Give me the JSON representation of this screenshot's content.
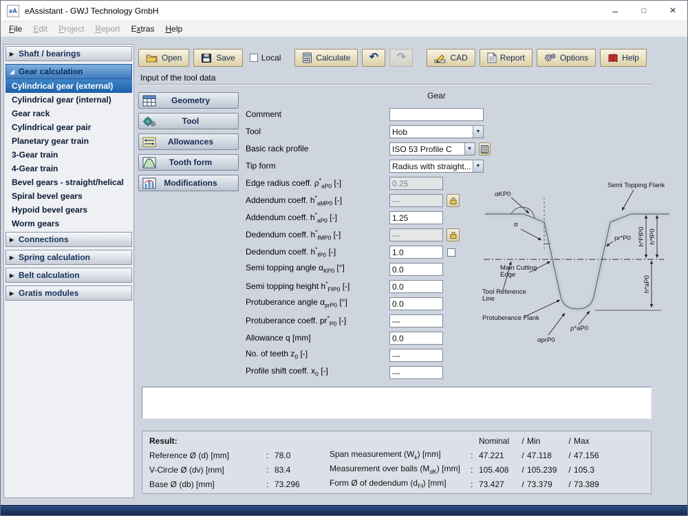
{
  "window": {
    "title": "eAssistant - GWJ Technology GmbH",
    "icon_text": "eA",
    "minimize": "–",
    "maximize": "□",
    "close": "×"
  },
  "menu": {
    "items": [
      {
        "pre": "",
        "key": "F",
        "post": "ile"
      },
      {
        "pre": "",
        "key": "E",
        "post": "dit"
      },
      {
        "pre": "",
        "key": "P",
        "post": "roject"
      },
      {
        "pre": "",
        "key": "R",
        "post": "eport"
      },
      {
        "pre": "E",
        "key": "x",
        "post": "tras"
      },
      {
        "pre": "",
        "key": "H",
        "post": "elp"
      }
    ]
  },
  "icons": {
    "collapsed_arrow": "▶",
    "expanded_arrow": "◢",
    "dropdown_arrow": "▼",
    "undo": "↶",
    "redo": "↷"
  },
  "sidebar": {
    "sections": {
      "shaft": "Shaft / bearings",
      "gear": "Gear calculation",
      "connections": "Connections",
      "spring": "Spring calculation",
      "belt": "Belt calculation",
      "gratis": "Gratis modules"
    },
    "gear_items": [
      "Cylindrical gear (external)",
      "Cylindrical gear (internal)",
      "Gear rack",
      "Cylindrical gear pair",
      "Planetary gear train",
      "3-Gear train",
      "4-Gear train",
      "Bevel gears - straight/helical",
      "Spiral bevel gears",
      "Hypoid bevel gears",
      "Worm gears"
    ]
  },
  "toolbar": {
    "open": "Open",
    "save": "Save",
    "local": "Local",
    "calculate": "Calculate",
    "cad": "CAD",
    "report": "Report",
    "options": "Options",
    "help": "Help"
  },
  "main": {
    "section_title": "Input of the tool data",
    "column_header": "Gear"
  },
  "nav_buttons": [
    "Geometry",
    "Tool",
    "Allowances",
    "Tooth form",
    "Modifications"
  ],
  "form": {
    "fields": [
      {
        "l1": "Comment",
        "value": ""
      },
      {
        "l1": "Tool",
        "value": "Hob"
      },
      {
        "l1": "Basic rack profile",
        "value": "ISO 53 Profile C"
      },
      {
        "l1": "Tip form",
        "value": "Radius with straight..."
      },
      {
        "l1": "Edge radius coeff. ρ",
        "sup": "*",
        "sub": "aP0",
        "l2": " [-]",
        "value": "0.25"
      },
      {
        "l1": "Addendum coeff. h",
        "sup": "*",
        "sub": "aMP0",
        "l2": " [-]",
        "value": "---"
      },
      {
        "l1": "Addendum coeff. h",
        "sup": "*",
        "sub": "aP0",
        "l2": " [-]",
        "value": "1.25"
      },
      {
        "l1": "Dedendum coeff. h",
        "sup": "*",
        "sub": "fMP0",
        "l2": " [-]",
        "value": "---"
      },
      {
        "l1": "Dedendum coeff. h",
        "sup": "*",
        "sub": "fP0",
        "l2": " [-]",
        "value": "1.0"
      },
      {
        "l1": "Semi topping angle α",
        "sub": "KP0",
        "l2": " [°]",
        "value": "0.0"
      },
      {
        "l1": "Semi topping height h",
        "sup": "*",
        "sub": "FfP0",
        "l2": " [-]",
        "value": "0.0"
      },
      {
        "l1": "Protuberance angle α",
        "sub": "prP0",
        "l2": " [°]",
        "value": "0.0"
      },
      {
        "l1": "Protuberance coeff. pr",
        "sup": "*",
        "sub": "P0",
        "l2": " [-]",
        "value": "---"
      },
      {
        "l1": "Allowance q [mm]",
        "value": "0.0"
      },
      {
        "l1": "No. of teeth z",
        "sub": "0",
        "l2": " [-]",
        "value": "---"
      },
      {
        "l1": "Profile shift coeff. x",
        "sub": "0",
        "l2": " [-]",
        "value": "---"
      }
    ]
  },
  "diagram": {
    "labels": {
      "semi_topping_flank": "Semi Topping Flank",
      "alpha_kp0": "αKP0",
      "alpha": "α",
      "main_cutting_1": "Main Cutting",
      "main_cutting_2": "Edge",
      "tool_ref_1": "Tool Reference",
      "tool_ref_2": "Line",
      "protuberance_flank": "Protuberance Flank",
      "h_ffp0": "h*FfP0",
      "h_fp0": "h*fP0",
      "pr_p0": "pr*P0",
      "h_ap0": "h*aP0",
      "rho_ap0": "ρ*aP0",
      "alpha_prp0": "αprP0"
    }
  },
  "result": {
    "title": "Result:",
    "colon": ":",
    "slash": "/",
    "cols": {
      "nominal": "Nominal",
      "min": "Min",
      "max": "Max"
    },
    "rows": [
      {
        "label": "Reference Ø (d) [mm]",
        "value": "78.0",
        "rlabel1": "Span measurement (W",
        "rsub": "k",
        "rlabel2": ") [mm]",
        "nominal": "47.221",
        "min": "47.118",
        "max": "47.156"
      },
      {
        "label": "V-Circle Ø (dv) [mm]",
        "value": "83.4",
        "rlabel1": "Measurement over balls (M",
        "rsub": "dK",
        "rlabel2": ") [mm]",
        "nominal": "105.408",
        "min": "105.239",
        "max": "105.3"
      },
      {
        "label": "Base Ø (db) [mm]",
        "value": "73.296",
        "rlabel1": "Form Ø of dedendum (d",
        "rsub": "Ff",
        "rlabel2": ") [mm]",
        "nominal": "73.427",
        "min": "73.379",
        "max": "73.389"
      }
    ]
  }
}
